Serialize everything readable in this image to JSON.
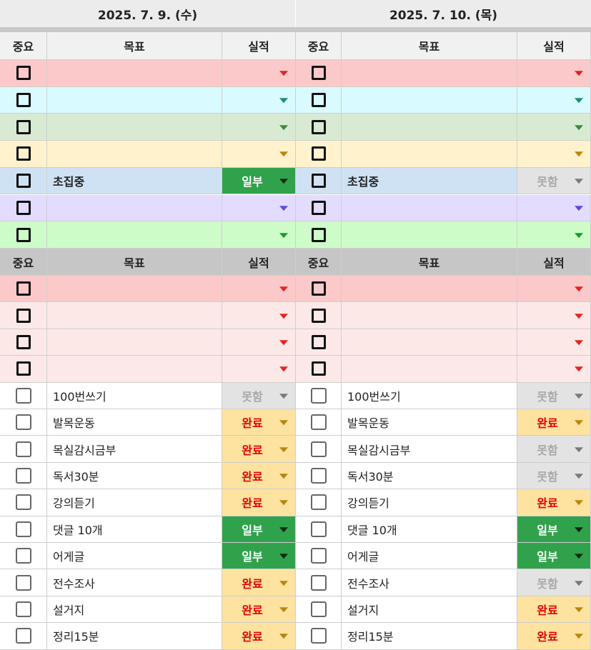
{
  "days": [
    {
      "date": "2025. 7. 9. (수)"
    },
    {
      "date": "2025. 7. 10. (목)"
    }
  ],
  "headers": {
    "importance": "중요",
    "goal": "목표",
    "performance": "실적"
  },
  "colors": {
    "red_row": "#fbc9c9",
    "pink_row": "#fde8e8",
    "cyan_row": "#d9fbff",
    "green_row": "#d9ead3",
    "yellow_row": "#fff2cc",
    "blue_row": "#cfe2f3",
    "lavender_row": "#e3dcff",
    "mint_row": "#cdfcc9",
    "header_gray": "#c6c6c6",
    "header_light": "#f1f1f1",
    "status_complete_bg": "#fde2a0",
    "status_complete_text": "#e50000",
    "status_partial_bg": "#31a24c",
    "status_partial_text": "#ffffff",
    "status_fail_bg": "#e3e3e3",
    "status_fail_text": "#a8a8a8"
  },
  "section1_rows": [
    {
      "color": "#fbc9c9",
      "arrow": "#e52222",
      "day1": {
        "goal": "",
        "status": ""
      },
      "day2": {
        "goal": "",
        "status": ""
      }
    },
    {
      "color": "#d9fbff",
      "arrow": "#1e8a80",
      "day1": {
        "goal": "",
        "status": ""
      },
      "day2": {
        "goal": "",
        "status": ""
      }
    },
    {
      "color": "#d9ead3",
      "arrow": "#3c8a3c",
      "day1": {
        "goal": "",
        "status": ""
      },
      "day2": {
        "goal": "",
        "status": ""
      }
    },
    {
      "color": "#fff2cc",
      "arrow": "#b8860b",
      "day1": {
        "goal": "",
        "status": ""
      },
      "day2": {
        "goal": "",
        "status": ""
      }
    },
    {
      "color": "#cfe2f3",
      "arrow": "#444444",
      "day1": {
        "goal": "초집중",
        "status": "partial"
      },
      "day2": {
        "goal": "초집중",
        "status": "fail"
      }
    },
    {
      "color": "#e3dcff",
      "arrow": "#5a4de0",
      "day1": {
        "goal": "",
        "status": ""
      },
      "day2": {
        "goal": "",
        "status": ""
      }
    },
    {
      "color": "#cdfcc9",
      "arrow": "#1f9a2a",
      "day1": {
        "goal": "",
        "status": ""
      },
      "day2": {
        "goal": "",
        "status": ""
      }
    }
  ],
  "section2_rows": [
    {
      "color": "#fbc9c9",
      "arrow": "#e52222",
      "style": "bold",
      "day1": {
        "goal": "",
        "status": ""
      },
      "day2": {
        "goal": "",
        "status": ""
      }
    },
    {
      "color": "#fde8e8",
      "arrow": "#e52222",
      "style": "bold",
      "day1": {
        "goal": "",
        "status": ""
      },
      "day2": {
        "goal": "",
        "status": ""
      }
    },
    {
      "color": "#fde8e8",
      "arrow": "#e52222",
      "style": "bold",
      "day1": {
        "goal": "",
        "status": ""
      },
      "day2": {
        "goal": "",
        "status": ""
      }
    },
    {
      "color": "#fde8e8",
      "arrow": "#e52222",
      "style": "bold",
      "day1": {
        "goal": "",
        "status": ""
      },
      "day2": {
        "goal": "",
        "status": ""
      }
    },
    {
      "color": "#ffffff",
      "arrow": "#666666",
      "style": "thin",
      "day1": {
        "goal": "100번쓰기",
        "status": "fail"
      },
      "day2": {
        "goal": "100번쓰기",
        "status": "fail"
      }
    },
    {
      "color": "#ffffff",
      "arrow": "#666666",
      "style": "thin",
      "day1": {
        "goal": "발목운동",
        "status": "complete"
      },
      "day2": {
        "goal": "발목운동",
        "status": "complete"
      }
    },
    {
      "color": "#ffffff",
      "arrow": "#666666",
      "style": "thin",
      "day1": {
        "goal": "목실감시금부",
        "status": "complete"
      },
      "day2": {
        "goal": "목실감시금부",
        "status": "fail"
      }
    },
    {
      "color": "#ffffff",
      "arrow": "#666666",
      "style": "thin",
      "day1": {
        "goal": "독서30분",
        "status": "complete"
      },
      "day2": {
        "goal": "독서30분",
        "status": "fail"
      }
    },
    {
      "color": "#ffffff",
      "arrow": "#666666",
      "style": "thin",
      "day1": {
        "goal": "강의듣기",
        "status": "complete"
      },
      "day2": {
        "goal": "강의듣기",
        "status": "complete"
      }
    },
    {
      "color": "#ffffff",
      "arrow": "#666666",
      "style": "thin",
      "day1": {
        "goal": "댓글 10개",
        "status": "partial"
      },
      "day2": {
        "goal": "댓글 10개",
        "status": "partial"
      }
    },
    {
      "color": "#ffffff",
      "arrow": "#666666",
      "style": "thin",
      "day1": {
        "goal": "어게글",
        "status": "partial"
      },
      "day2": {
        "goal": "어게글",
        "status": "partial"
      }
    },
    {
      "color": "#ffffff",
      "arrow": "#666666",
      "style": "thin",
      "day1": {
        "goal": "전수조사",
        "status": "complete"
      },
      "day2": {
        "goal": "전수조사",
        "status": "fail"
      }
    },
    {
      "color": "#ffffff",
      "arrow": "#666666",
      "style": "thin",
      "day1": {
        "goal": "설거지",
        "status": "complete"
      },
      "day2": {
        "goal": "설거지",
        "status": "complete"
      }
    },
    {
      "color": "#ffffff",
      "arrow": "#666666",
      "style": "thin",
      "day1": {
        "goal": "정리15분",
        "status": "complete"
      },
      "day2": {
        "goal": "정리15분",
        "status": "complete"
      }
    }
  ],
  "status_labels": {
    "complete": "완료",
    "partial": "일부",
    "fail": "못함"
  }
}
